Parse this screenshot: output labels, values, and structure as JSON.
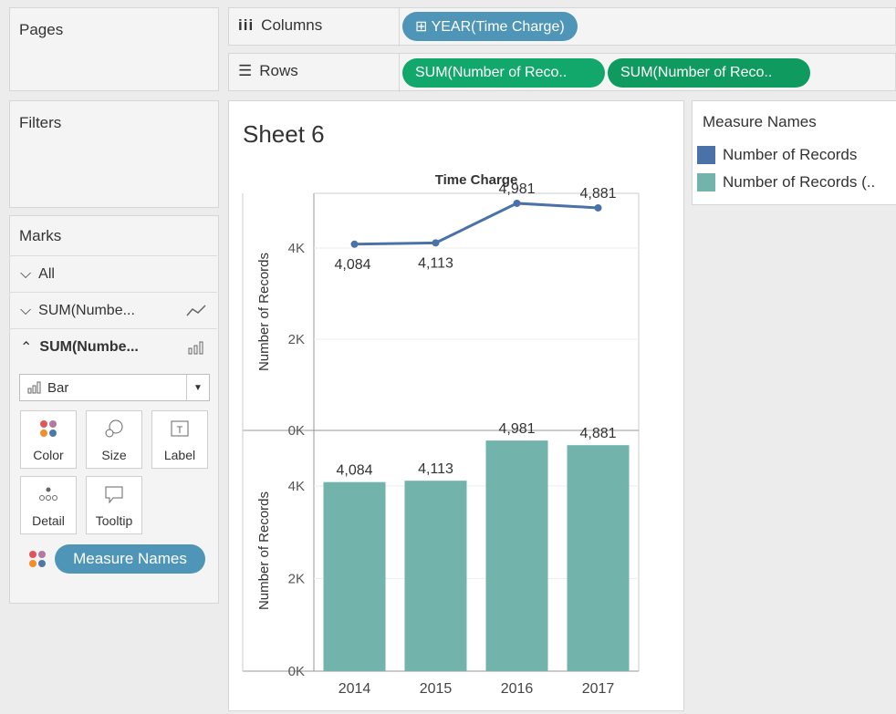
{
  "pages": {
    "label": "Pages"
  },
  "shelves": {
    "columns_label": "Columns",
    "rows_label": "Rows",
    "columns_pill": "⊞ YEAR(Time Charge)",
    "rows_pill_1": "SUM(Number of Reco..",
    "rows_pill_2": "SUM(Number of Reco.."
  },
  "filters": {
    "label": "Filters"
  },
  "marks": {
    "label": "Marks",
    "all_label": "All",
    "item1_label": "SUM(Numbe...",
    "item2_label": "SUM(Numbe...",
    "mark_type": "Bar",
    "cards": [
      "Color",
      "Size",
      "Label",
      "Detail",
      "Tooltip"
    ],
    "measure_pill": "Measure Names"
  },
  "sheet": {
    "title": "Sheet 6"
  },
  "legend": {
    "title": "Measure Names",
    "items": [
      {
        "label": "Number of Records",
        "color": "#4a72a8"
      },
      {
        "label": "Number of Records (..",
        "color": "#72b3ac"
      }
    ]
  },
  "chart_data": [
    {
      "type": "line",
      "title": "Time Charge",
      "categories": [
        "2014",
        "2015",
        "2016",
        "2017"
      ],
      "values": [
        4084,
        4113,
        4981,
        4881
      ],
      "data_labels": [
        "4,084",
        "4,113",
        "4,981",
        "4,881"
      ],
      "ylabel": "Number of Records",
      "yticks": [
        "0K",
        "2K",
        "4K"
      ],
      "ylim": [
        0,
        5200
      ],
      "color": "#4a72a8"
    },
    {
      "type": "bar",
      "categories": [
        "2014",
        "2015",
        "2016",
        "2017"
      ],
      "values": [
        4084,
        4113,
        4981,
        4881
      ],
      "data_labels": [
        "4,084",
        "4,113",
        "4,981",
        "4,881"
      ],
      "ylabel": "Number of Records",
      "yticks": [
        "0K",
        "2K",
        "4K"
      ],
      "ylim": [
        0,
        5200
      ],
      "color": "#72b3ac"
    }
  ]
}
